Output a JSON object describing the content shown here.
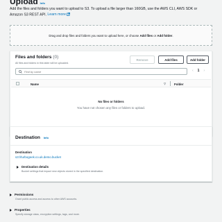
{
  "page": {
    "title": "Upload",
    "info": "Info",
    "intro_text": "Add the files and folders you want to upload to S3. To upload a file larger than 160GB, use the AWS CLI, AWS SDK or Amazon S3 REST API.",
    "learn_more": "Learn more"
  },
  "dropzone": {
    "text_before": "Drag and drop files and folders you want to upload here, or choose",
    "add_files": "Add files",
    "or": "or",
    "add_folder": "Add folder"
  },
  "files_panel": {
    "title": "Files and folders",
    "count": "(0)",
    "subtitle": "All files and folders in this table will be uploaded.",
    "remove_label": "Remove",
    "add_files_label": "Add files",
    "add_folder_label": "Add folder",
    "search_placeholder": "Find by name",
    "page_number": "1",
    "columns": {
      "name": "Name",
      "folder": "Folder"
    },
    "empty_title": "No files or folders",
    "empty_desc": "You have not chosen any files or folders to upload."
  },
  "destination": {
    "title": "Destination",
    "info": "Info",
    "label": "Destination",
    "value": "s3://turbogeek.co.uk.demo.bucket",
    "details_title": "Destination details",
    "details_desc": "Bucket settings that impact new objects stored in the specified destination."
  },
  "permissions": {
    "title": "Permissions",
    "desc": "Grant public access and access to other AWS accounts."
  },
  "properties": {
    "title": "Properties",
    "desc": "Specify storage class, encryption settings, tags, and more."
  },
  "colors": {
    "link": "#0073bb",
    "background": "#f2f3f3",
    "panel": "#ffffff",
    "muted_text": "#687078"
  },
  "icons": {
    "learn_more": "external-link-icon",
    "search": "search-icon",
    "prev": "chevron-left-icon",
    "next": "chevron-right-icon",
    "sort": "sort-down-icon",
    "expand": "caret-right-icon",
    "expanded": "caret-down-icon"
  }
}
